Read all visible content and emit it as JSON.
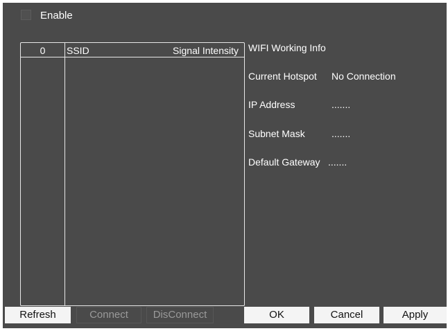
{
  "enable": {
    "label": "Enable",
    "checked": false
  },
  "wifi_list": {
    "header": {
      "index": "0",
      "ssid": "SSID",
      "signal": "Signal Intensity"
    },
    "rows": []
  },
  "info": {
    "title": "WIFI Working Info",
    "current_hotspot_label": "Current Hotspot",
    "current_hotspot_value": "No Connection",
    "ip_label": "IP Address",
    "ip_value": ".......",
    "subnet_label": "Subnet Mask",
    "subnet_value": ".......",
    "gateway_label": "Default Gateway",
    "gateway_value": "......."
  },
  "buttons": {
    "refresh": "Refresh",
    "connect": "Connect",
    "disconnect": "DisConnect",
    "ok": "OK",
    "cancel": "Cancel",
    "apply": "Apply"
  }
}
